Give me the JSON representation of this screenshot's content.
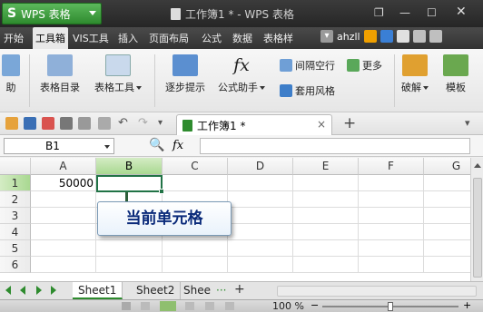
{
  "app": {
    "logo_text": "WPS 表格",
    "window_title": "工作簿1 * - WPS 表格"
  },
  "menu": {
    "tabs": [
      "开始",
      "工具箱",
      "VIS工具",
      "插入",
      "页面布局",
      "公式",
      "数据",
      "表格样"
    ],
    "active_index": 1,
    "user": "ahzll"
  },
  "ribbon": {
    "partial_label": "助",
    "biaoge_mulu": "表格目录",
    "biaoge_gongju": "表格工具",
    "zhubu_tishi": "逐步提示",
    "gongshi_zhushou": "公式助手",
    "jiange_kongxing": "间隔空行",
    "taoyong_fengge": "套用风格",
    "gengduo": "更多",
    "pojie": "破解",
    "moban": "模板"
  },
  "doc_tab": {
    "title": "工作簿1 *",
    "close_glyph": "×",
    "add_glyph": "+"
  },
  "formula_bar": {
    "name_box": "B1",
    "fx_label": "fx",
    "formula": ""
  },
  "grid": {
    "columns": [
      "A",
      "B",
      "C",
      "D",
      "E",
      "F",
      "G"
    ],
    "rows": [
      "1",
      "2",
      "3",
      "4",
      "5",
      "6"
    ],
    "selected_column": "B",
    "selected_row": "1",
    "cells": {
      "A1": "50000"
    }
  },
  "callout": {
    "text": "当前单元格"
  },
  "sheets": {
    "tabs": [
      "Sheet1",
      "Sheet2",
      "Shee"
    ],
    "active_index": 0,
    "more_glyph": "···",
    "add_glyph": "+"
  },
  "status": {
    "zoom": "100 %"
  },
  "colors": {
    "accent_green": "#217346",
    "logo_green": "#2e8b2e",
    "callout_text": "#0a2a7a"
  }
}
